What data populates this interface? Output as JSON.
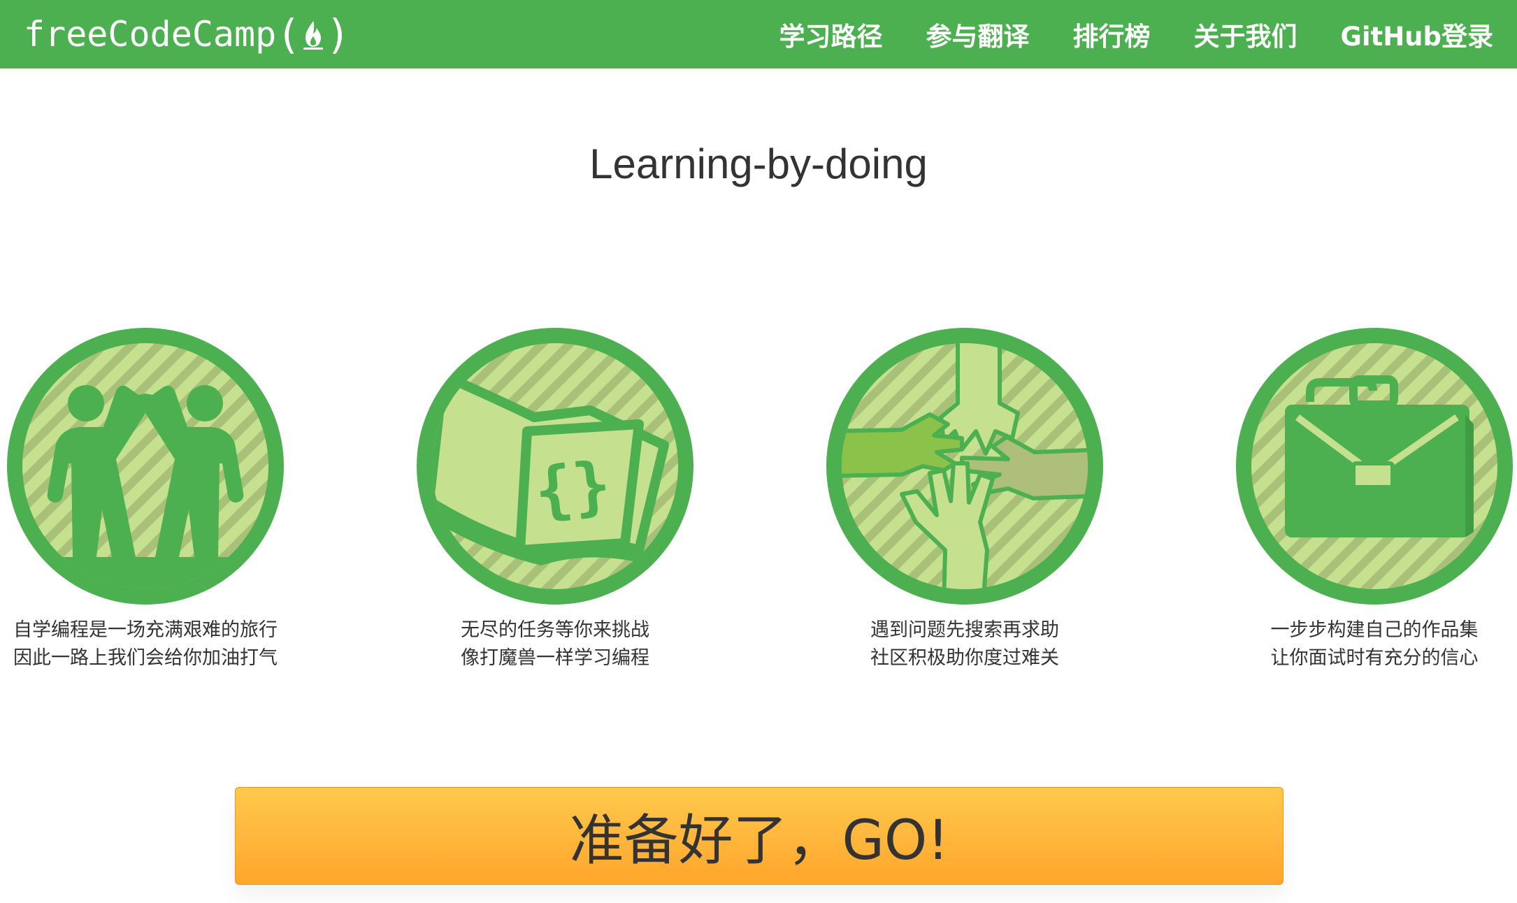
{
  "brand": {
    "name": "freeCodeCamp",
    "open_paren": "(",
    "close_paren": ")",
    "icon": "flame-icon"
  },
  "nav": {
    "items": [
      {
        "label": "学习路径"
      },
      {
        "label": "参与翻译"
      },
      {
        "label": "排行榜"
      },
      {
        "label": "关于我们"
      },
      {
        "label": "GitHub登录"
      }
    ]
  },
  "main": {
    "title": "Learning-by-doing",
    "features": [
      {
        "icon": "high-five-people-icon",
        "line1": "自学编程是一场充满艰难的旅行",
        "line2": "因此一路上我们会给你加油打气"
      },
      {
        "icon": "code-book-icon",
        "line1": "无尽的任务等你来挑战",
        "line2": "像打魔兽一样学习编程"
      },
      {
        "icon": "helping-hands-icon",
        "line1": "遇到问题先搜索再求助",
        "line2": "社区积极助你度过难关"
      },
      {
        "icon": "briefcase-icon",
        "line1": "一步步构建自己的作品集",
        "line2": "让你面试时有充分的信心"
      }
    ],
    "cta_label": "准备好了，GO!"
  },
  "colors": {
    "brand_green": "#4caf50",
    "badge_light": "#c5e08f",
    "badge_stripe": "#a9c079",
    "cta_orange": "#ffb03b"
  }
}
